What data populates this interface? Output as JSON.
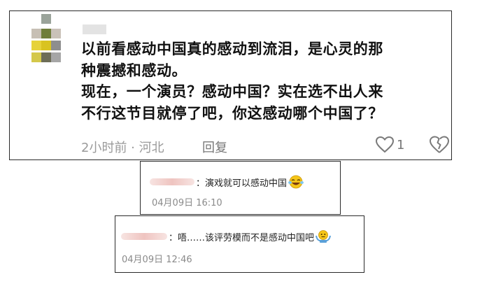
{
  "main_comment": {
    "lines": [
      "以前看感动中国真的感动到流泪，是心灵的那",
      "种震撼和感动。",
      "现在，一个演员？感动中国？实在选不出人来",
      "不行这节目就停了吧，你这感动哪个中国了？"
    ],
    "meta": "2小时前 · 河北",
    "reply_label": "回复",
    "like_count": "1",
    "icons": {
      "like": "heart-outline-icon",
      "dislike": "broken-heart-icon"
    }
  },
  "replies": [
    {
      "text": "：演戏就可以感动中国",
      "date": "04月09日 16:10",
      "emoji": "laughing-tears-emoji"
    },
    {
      "text": "：唔……该评劳模而不是感动中国吧",
      "date": "04月09日 12:46",
      "emoji": "shrug-emoji"
    }
  ],
  "colors": {
    "meta_gray": "#9a9a9a",
    "border": "#2a2a2a",
    "emoji_yellow": "#f5c518"
  }
}
